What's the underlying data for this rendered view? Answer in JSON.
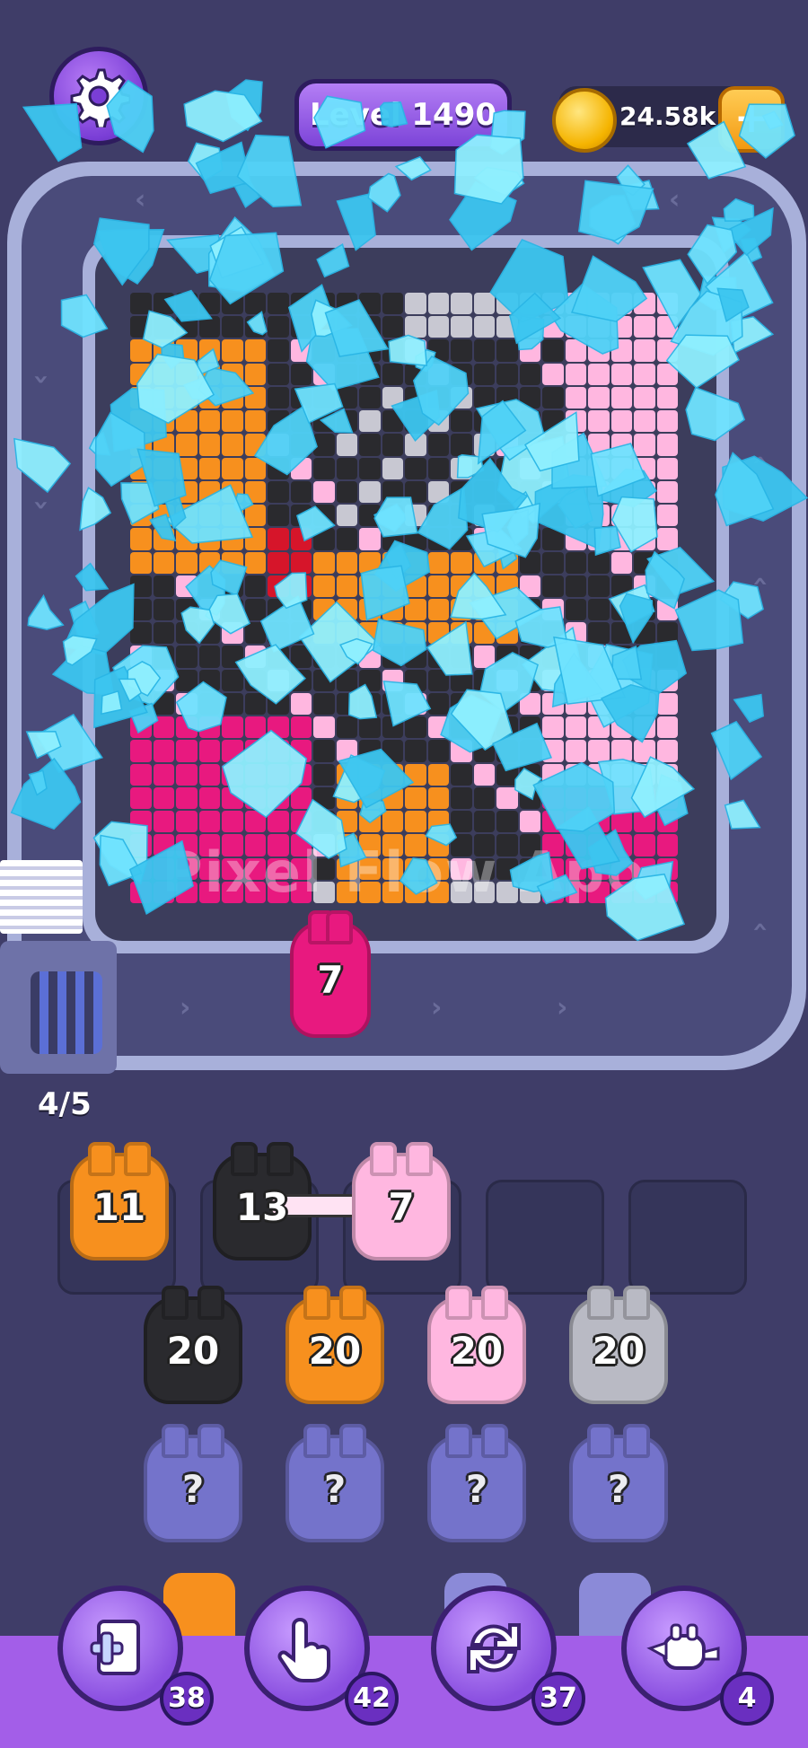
{
  "header": {
    "level_label": "Level 1490",
    "coins": "24.58k",
    "add_coins_symbol": "+"
  },
  "board": {
    "watermark": "Pixel Flow Apo",
    "colors": {
      "orange": "#f7901e",
      "pink": "#ffb7e0",
      "magenta": "#e8197f",
      "black": "#2a2a2e",
      "gray": "#c8c8d2",
      "red": "#d6152a",
      "ice": "#6fe3ff"
    }
  },
  "conveyor_pig": {
    "count": "7",
    "color": "#e8197f"
  },
  "capacity": "4/5",
  "slots": [
    {
      "count": "11",
      "color": "#f7901e"
    },
    {
      "count": "13",
      "color": "#2a2a2e"
    },
    {
      "count": "7",
      "color": "#ffb7e0"
    },
    {
      "count": "",
      "color": ""
    },
    {
      "count": "",
      "color": ""
    }
  ],
  "queue_row1": [
    {
      "count": "20",
      "color": "#2a2a2e"
    },
    {
      "count": "20",
      "color": "#f7901e"
    },
    {
      "count": "20",
      "color": "#ffb7e0"
    },
    {
      "count": "20",
      "color": "#b9bac4"
    }
  ],
  "queue_row2": [
    {
      "count": "?",
      "color": "#7a79d6"
    },
    {
      "count": "?",
      "color": "#7a79d6"
    },
    {
      "count": "?",
      "color": "#7a79d6"
    },
    {
      "count": "?",
      "color": "#7a79d6"
    }
  ],
  "toolbar": [
    {
      "icon": "add-slot-icon",
      "count": "38"
    },
    {
      "icon": "hand-pointer-icon",
      "count": "42"
    },
    {
      "icon": "shuffle-icon",
      "count": "37"
    },
    {
      "icon": "pig-plane-icon",
      "count": "4"
    }
  ]
}
